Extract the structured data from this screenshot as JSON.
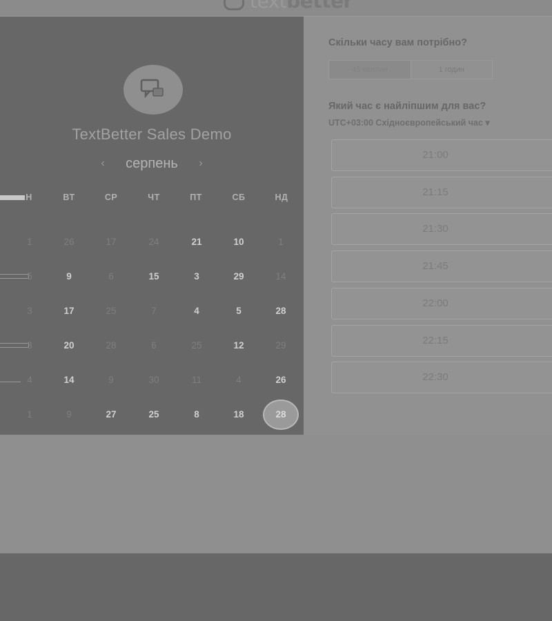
{
  "brand": {
    "name_light": "text",
    "name_bold": "better"
  },
  "event": {
    "title": "TextBetter Sales Demo",
    "icon": "chat-bubble-icon"
  },
  "calendar": {
    "month": "серпень",
    "prev_icon": "‹",
    "next_icon": "›",
    "weekdays": [
      "Н",
      "ВТ",
      "СР",
      "ЧТ",
      "ПТ",
      "СБ",
      "НД"
    ],
    "weeks": [
      [
        "1",
        "26",
        "17",
        "24",
        "21",
        "10",
        "1"
      ],
      [
        "5",
        "9",
        "6",
        "15",
        "3",
        "29",
        "14"
      ],
      [
        "3",
        "17",
        "25",
        "7",
        "4",
        "5",
        "28"
      ],
      [
        "3",
        "20",
        "28",
        "6",
        "25",
        "12",
        "29"
      ],
      [
        "4",
        "14",
        "9",
        "30",
        "11",
        "4",
        "26"
      ],
      [
        "1",
        "9",
        "27",
        "25",
        "8",
        "18",
        "28"
      ]
    ],
    "selected_day": "28"
  },
  "duration": {
    "question": "Скільки часу вам потрібно?",
    "options": [
      "45 хвилин",
      "1 годин"
    ]
  },
  "times": {
    "question": "Який час є найліпшим для вас?",
    "timezone": "UTC+03:00 Східноєвропейський час ▾",
    "slots": [
      "21:00",
      "21:15",
      "21:30",
      "21:45",
      "22:00",
      "22:15",
      "22:30"
    ]
  },
  "colors": {
    "calendar_bg": "#676767",
    "panel_bg": "#919191"
  }
}
